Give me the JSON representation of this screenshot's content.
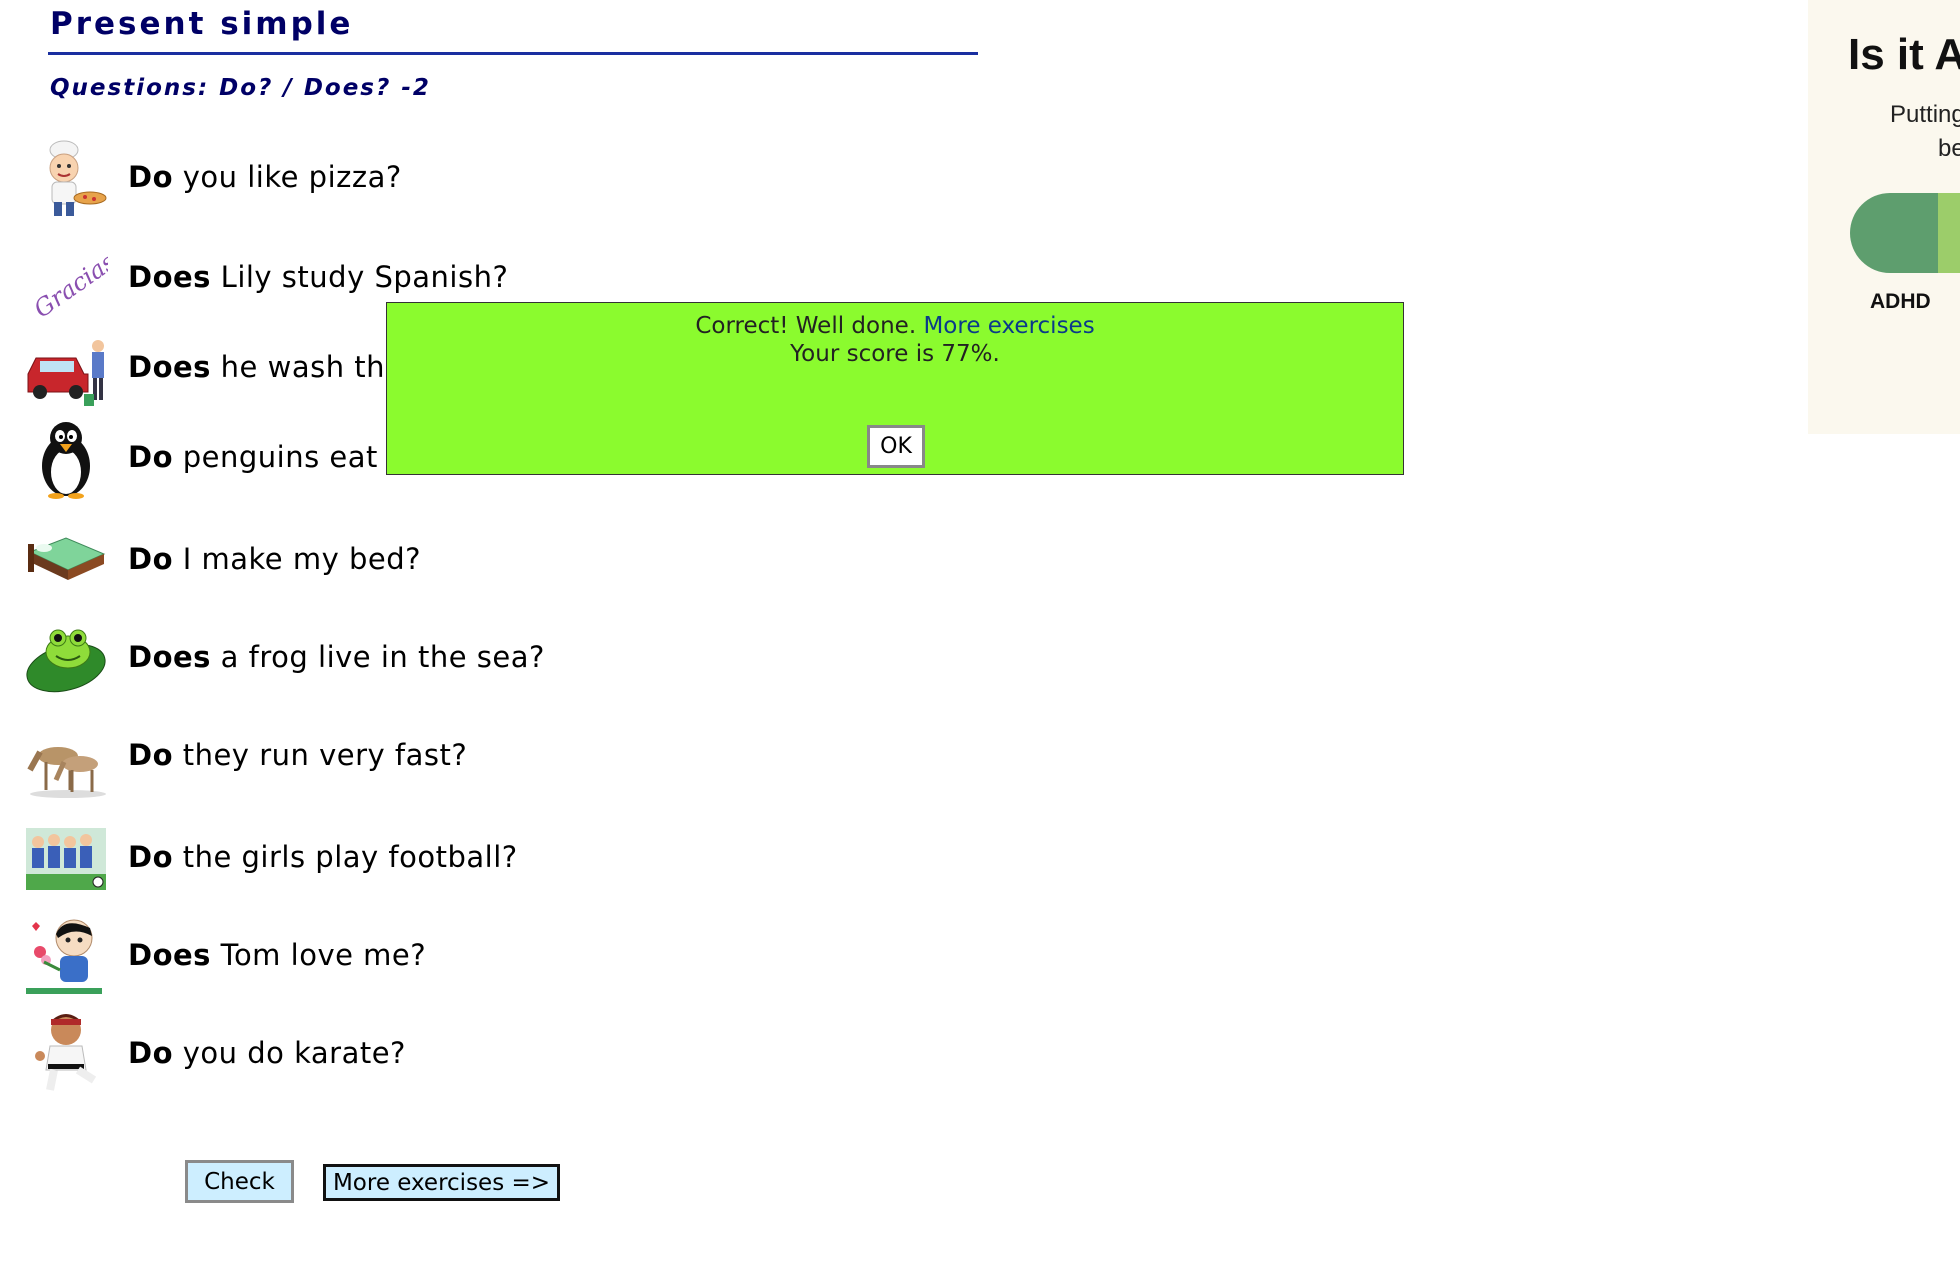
{
  "header": {
    "title": "Present simple",
    "subtitle": "Questions: Do? / Does? -2"
  },
  "questions": [
    {
      "aux": "Do",
      "rest": " you like pizza?",
      "icon": "chef-pizza-icon"
    },
    {
      "aux": "Does",
      "rest": " Lily study Spanish?",
      "icon": "gracias-text-icon"
    },
    {
      "aux": "Does",
      "rest": " he wash the",
      "icon": "car-wash-icon"
    },
    {
      "aux": "Do",
      "rest": " penguins eat f",
      "icon": "penguin-icon"
    },
    {
      "aux": "Do",
      "rest": " I make my bed?",
      "icon": "bed-icon"
    },
    {
      "aux": "Does",
      "rest": " a frog live in the sea?",
      "icon": "frog-icon"
    },
    {
      "aux": "Do",
      "rest": " they run very fast?",
      "icon": "deer-icon"
    },
    {
      "aux": "Do",
      "rest": " the girls play football?",
      "icon": "football-team-icon"
    },
    {
      "aux": "Does",
      "rest": " Tom love me?",
      "icon": "boy-flowers-icon"
    },
    {
      "aux": "Do",
      "rest": " you do karate?",
      "icon": "karate-icon"
    }
  ],
  "buttons": {
    "check": "Check",
    "more": "More exercises =>"
  },
  "modal": {
    "message": "Correct! Well done.",
    "link": "More exercises",
    "score": "Your score is 77%.",
    "ok": "OK",
    "color": "#8bfb2e"
  },
  "ad": {
    "heading": "Is it A",
    "line1": "Putting",
    "line2": "be",
    "tag": "ADHD"
  },
  "colors": {
    "title": "#000066",
    "button_bg": "#cdeeff"
  }
}
